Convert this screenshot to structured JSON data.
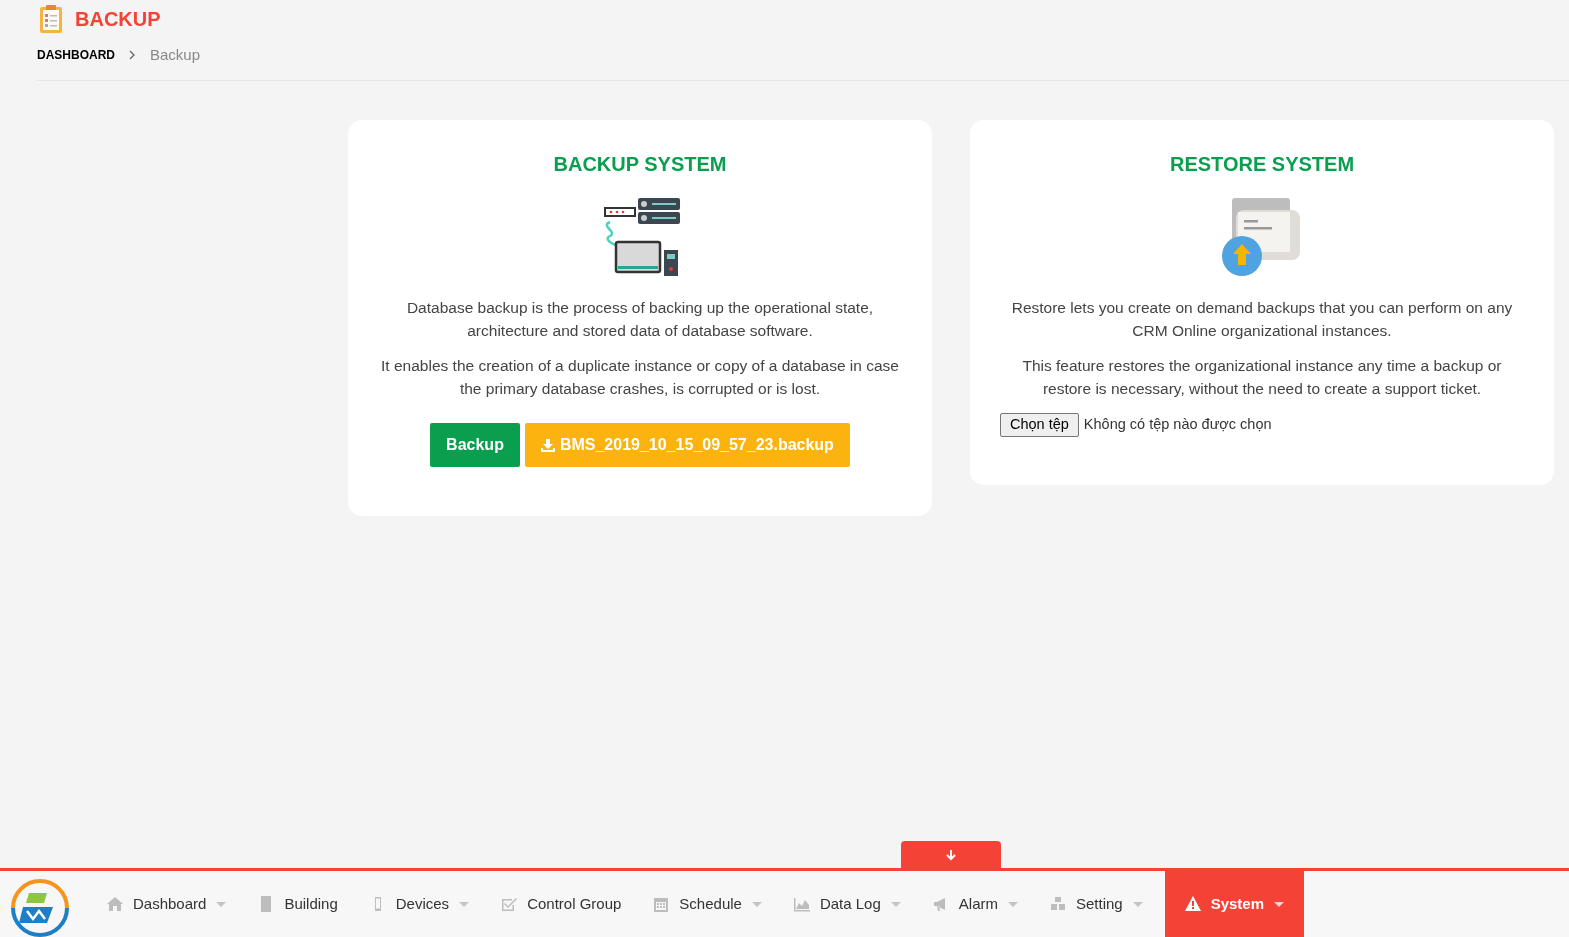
{
  "header": {
    "title": "BACKUP",
    "breadcrumb": [
      {
        "label": "DASHBOARD",
        "current": false
      },
      {
        "label": "Backup",
        "current": true
      }
    ]
  },
  "cards": [
    {
      "kind": "backup",
      "title": "BACKUP SYSTEM",
      "paragraphs": [
        "Database backup is the process of backing up the operational state, architecture and stored data of database software.",
        "It enables the creation of a duplicate instance or copy of a database in case the primary database crashes, is corrupted or is lost."
      ],
      "backup_button": "Backup",
      "download_button": "BMS_2019_10_15_09_57_23.backup"
    },
    {
      "kind": "restore",
      "title": "RESTORE SYSTEM",
      "paragraphs": [
        "Restore lets you create on demand backups that you can perform on any CRM Online organizational instances.",
        "This feature restores the organizational instance any time a backup or restore is necessary, without the need to create a support ticket."
      ],
      "file_button": "Chọn tệp",
      "file_status": "Không có tệp nào được chọn"
    }
  ],
  "nav": {
    "items": [
      {
        "label": "Dashboard",
        "dropdown": true,
        "selected": false
      },
      {
        "label": "Building",
        "dropdown": false,
        "selected": false
      },
      {
        "label": "Devices",
        "dropdown": true,
        "selected": false
      },
      {
        "label": "Control Group",
        "dropdown": false,
        "selected": false
      },
      {
        "label": "Schedule",
        "dropdown": true,
        "selected": false
      },
      {
        "label": "Data Log",
        "dropdown": true,
        "selected": false
      },
      {
        "label": "Alarm",
        "dropdown": true,
        "selected": false
      },
      {
        "label": "Setting",
        "dropdown": true,
        "selected": false
      },
      {
        "label": "System",
        "dropdown": true,
        "selected": true
      }
    ]
  }
}
